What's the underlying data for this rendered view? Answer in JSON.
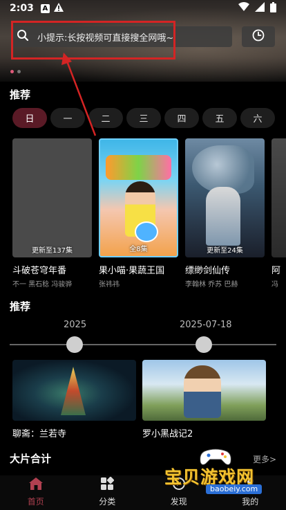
{
  "status_bar": {
    "time": "2:03",
    "notif_a": "A"
  },
  "search": {
    "placeholder": "小提示:长按视频可直接搜全网哦~"
  },
  "section_recommend": "推荐",
  "day_tabs": [
    "日",
    "一",
    "二",
    "三",
    "四",
    "五",
    "六"
  ],
  "active_day_index": 0,
  "cards": [
    {
      "title": "斗破苍穹年番",
      "cast": "不一  黑石稔  冯骏骅",
      "badge": "更新至137集"
    },
    {
      "title": "果小喵·果蔬王国",
      "cast": "张祎祎",
      "badge": "全8集"
    },
    {
      "title": "缥缈剑仙传",
      "cast": "李翰林  乔苏  巴赫",
      "badge": "更新至24集"
    },
    {
      "title": "阿",
      "cast": "冯",
      "badge": ""
    }
  ],
  "section_recommend_2": "推荐",
  "timeline": {
    "left_label": "2025",
    "right_label": "2025-07-18"
  },
  "wide_cards": [
    {
      "title": "聊斋：兰若寺"
    },
    {
      "title": "罗小黑战记2"
    }
  ],
  "section_collection": "大片合计",
  "more_label": "更多>",
  "bottom_nav": [
    {
      "label": "首页",
      "icon": "home-icon"
    },
    {
      "label": "分类",
      "icon": "category-icon"
    },
    {
      "label": "发现",
      "icon": "discover-icon"
    },
    {
      "label": "我的",
      "icon": "profile-icon"
    }
  ],
  "watermark": {
    "text": "宝贝游戏网",
    "url": "baobeiy.com"
  },
  "colors": {
    "accent": "#b04050",
    "annotation": "#d42424",
    "active_tab": "#5a1a26"
  }
}
